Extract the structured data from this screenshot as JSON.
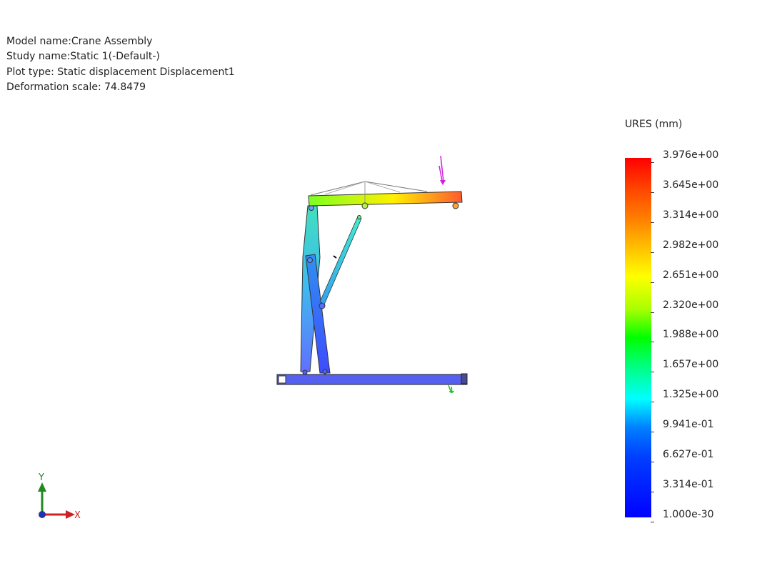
{
  "info": {
    "model": "Model name:Crane Assembly",
    "study": "Study name:Static 1(-Default-)",
    "plot": "Plot type: Static displacement Displacement1",
    "scale": "Deformation scale: 74.8479"
  },
  "legend": {
    "title": "URES (mm)",
    "labels": [
      "3.976e+00",
      "3.645e+00",
      "3.314e+00",
      "2.982e+00",
      "2.651e+00",
      "2.320e+00",
      "1.988e+00",
      "1.657e+00",
      "1.325e+00",
      "9.941e-01",
      "6.627e-01",
      "3.314e-01",
      "1.000e-30"
    ],
    "colors": [
      "#ff0000",
      "#0000ff"
    ]
  },
  "axes": {
    "y_label": "Y",
    "x_label": "X"
  }
}
